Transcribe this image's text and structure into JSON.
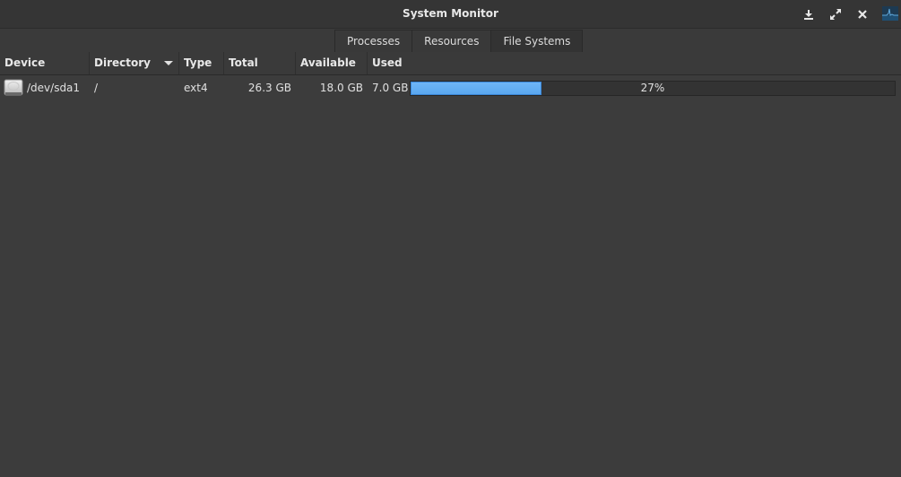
{
  "window": {
    "title": "System Monitor",
    "buttons": {
      "minimize": "download-minimize-icon",
      "maximize": "maximize-icon",
      "close": "close-icon",
      "app": "system-monitor-app-icon"
    }
  },
  "tabs": [
    {
      "label": "Processes",
      "active": false
    },
    {
      "label": "Resources",
      "active": false
    },
    {
      "label": "File Systems",
      "active": true
    }
  ],
  "table": {
    "columns": [
      "Device",
      "Directory",
      "Type",
      "Total",
      "Available",
      "Used"
    ],
    "sorted_column": "Directory",
    "rows": [
      {
        "icon": "hard-disk-icon",
        "device": "/dev/sda1",
        "directory": "/",
        "type": "ext4",
        "total": "26.3 GB",
        "available": "18.0 GB",
        "used": "7.0 GB",
        "used_percent": 27,
        "used_percent_label": "27%"
      }
    ]
  },
  "colors": {
    "accent": "#5aa7f0",
    "background": "#3c3c3c"
  }
}
